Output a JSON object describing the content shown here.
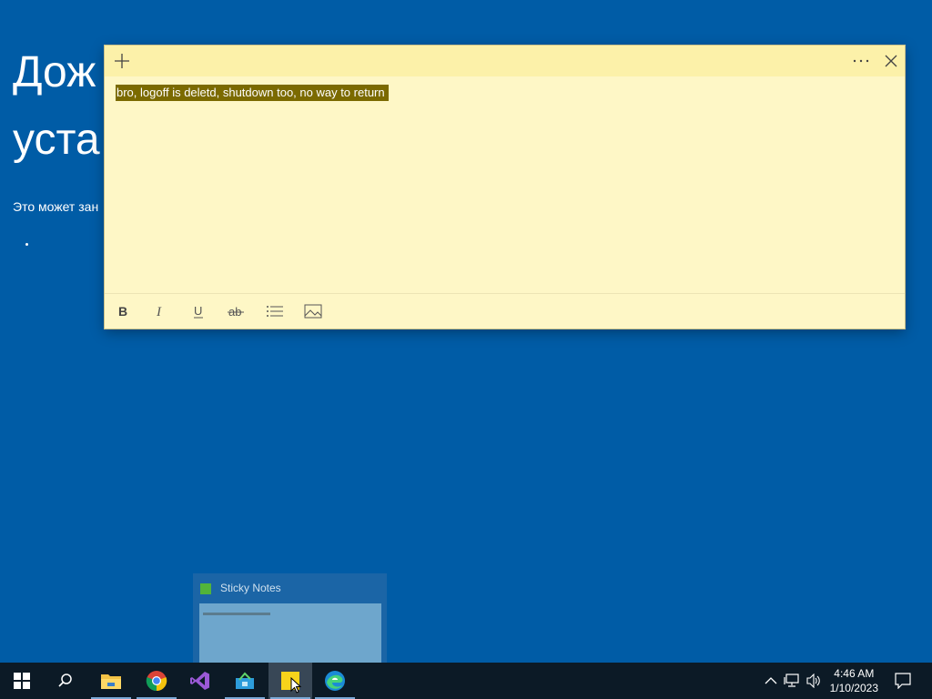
{
  "background": {
    "title_line1": "Дож",
    "title_line2": "уста",
    "subtitle": "Это может зан"
  },
  "note": {
    "text": "bro, logoff is deletd, shutdown too, no way to return",
    "accent_color": "#fcf1a9",
    "toolbar": [
      "bold-button",
      "italic-button",
      "underline-button",
      "strikethrough-button",
      "bullets-button",
      "image-button"
    ]
  },
  "thumbnail": {
    "title": "Sticky Notes"
  },
  "taskbar": {
    "apps": [
      "start",
      "search",
      "file-explorer",
      "chrome",
      "visual-studio",
      "app",
      "sticky-notes",
      "edge"
    ],
    "clock_time": "4:46 AM",
    "clock_date": "1/10/2023"
  }
}
